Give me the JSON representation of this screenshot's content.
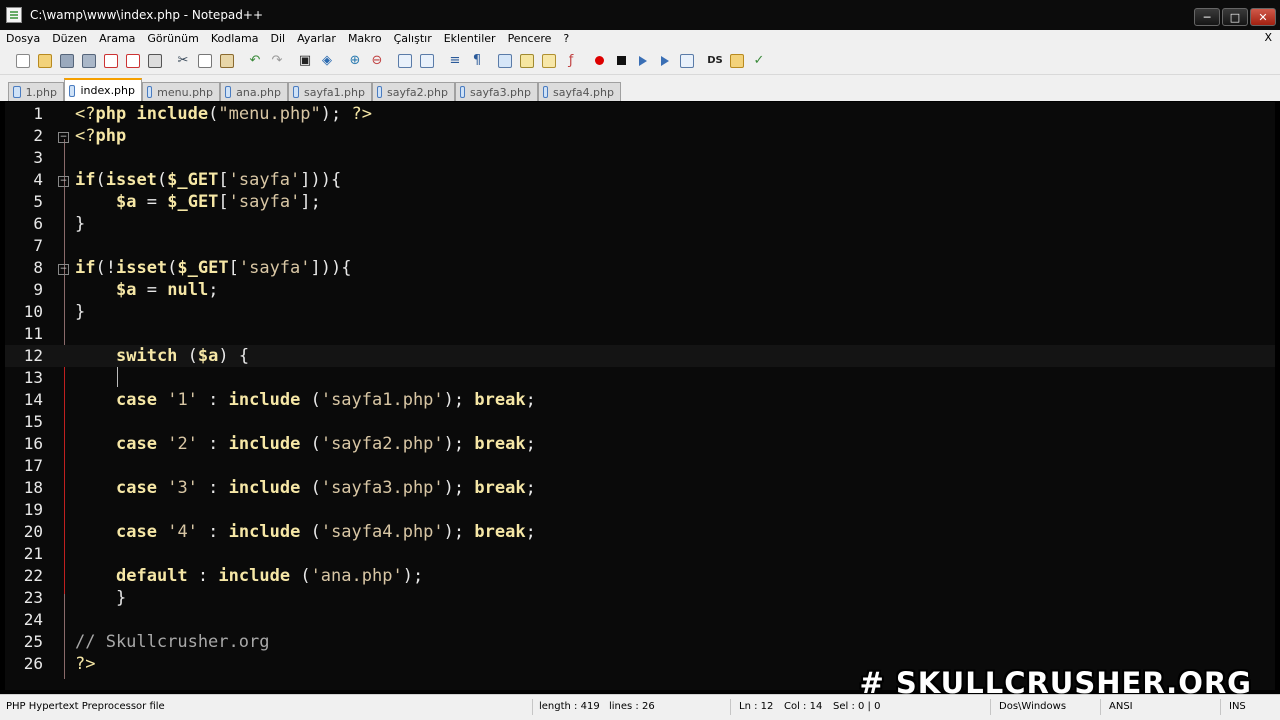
{
  "window": {
    "title": "C:\\wamp\\www\\index.php - Notepad++"
  },
  "menu": [
    "Dosya",
    "Düzen",
    "Arama",
    "Görünüm",
    "Kodlama",
    "Dil",
    "Ayarlar",
    "Makro",
    "Çalıştır",
    "Eklentiler",
    "Pencere",
    "?"
  ],
  "menu_close": "X",
  "toolbar": {
    "icons": [
      "new-file-icon",
      "open-file-icon",
      "save-icon",
      "save-all-icon",
      "close-icon",
      "close-all-icon",
      "print-icon",
      "cut-icon",
      "copy-icon",
      "paste-icon",
      "undo-icon",
      "redo-icon",
      "find-icon",
      "replace-icon",
      "zoom-in-icon",
      "zoom-out-icon",
      "sync-vertical-icon",
      "sync-horizontal-icon",
      "word-wrap-icon",
      "show-all-chars-icon",
      "indent-guide-icon",
      "user-lang-icon",
      "doc-map-icon",
      "function-list-icon",
      "record-macro-icon",
      "stop-macro-icon",
      "play-macro-icon",
      "run-macro-multiple-icon",
      "save-macro-icon",
      "ds-icon",
      "trim-icon",
      "spellcheck-icon"
    ],
    "ds_label": "DS"
  },
  "tabs": [
    {
      "label": "1.php",
      "active": false
    },
    {
      "label": "index.php",
      "active": true
    },
    {
      "label": "menu.php",
      "active": false
    },
    {
      "label": "ana.php",
      "active": false
    },
    {
      "label": "sayfa1.php",
      "active": false
    },
    {
      "label": "sayfa2.php",
      "active": false
    },
    {
      "label": "sayfa3.php",
      "active": false
    },
    {
      "label": "sayfa4.php",
      "active": false
    }
  ],
  "editor": {
    "current_line": 12,
    "lines": [
      "<?php include(\"menu.php\"); ?>",
      "<?php",
      "",
      "if(isset($_GET['sayfa'])){",
      "    $a = $_GET['sayfa'];",
      "}",
      "",
      "if(!isset($_GET['sayfa'])){",
      "    $a = null;",
      "}",
      "",
      "    switch ($a) {",
      "",
      "    case '1' : include ('sayfa1.php'); break;",
      "",
      "    case '2' : include ('sayfa2.php'); break;",
      "",
      "    case '3' : include ('sayfa3.php'); break;",
      "",
      "    case '4' : include ('sayfa4.php'); break;",
      "",
      "    default : include ('ana.php');",
      "    }",
      "",
      "// Skullcrusher.org",
      "?>"
    ]
  },
  "watermark": "# SKULLCRUSHER.ORG",
  "status": {
    "file_type": "PHP Hypertext Preprocessor file",
    "length": "length : 419",
    "lines": "lines : 26",
    "ln": "Ln : 12",
    "col": "Col : 14",
    "sel": "Sel : 0 | 0",
    "eol": "Dos\\Windows",
    "encoding": "ANSI",
    "mode": "INS"
  }
}
